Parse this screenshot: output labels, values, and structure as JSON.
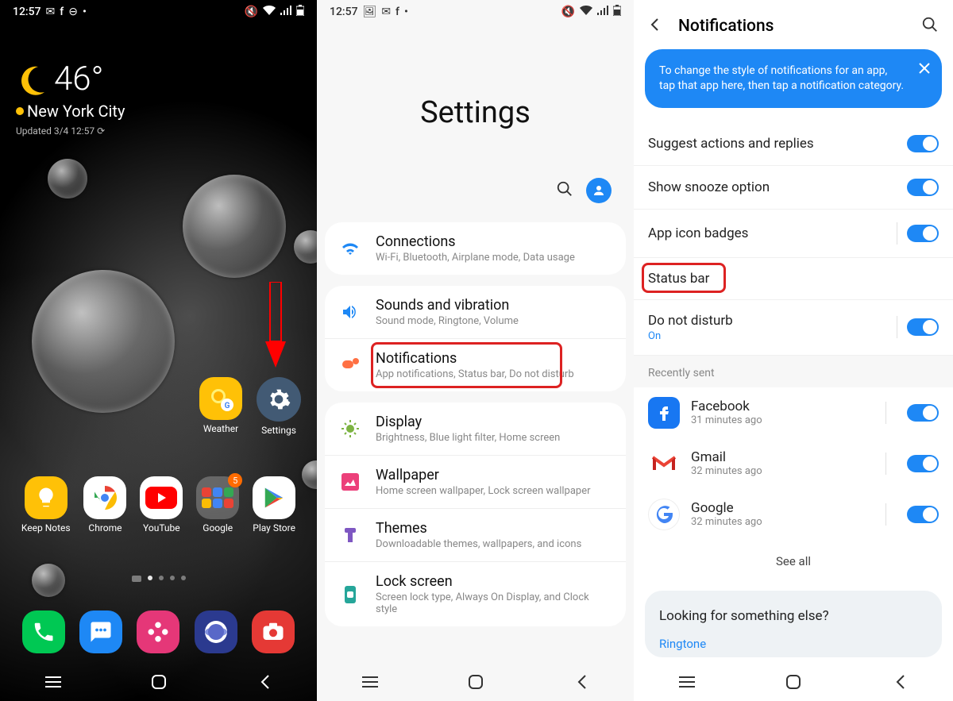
{
  "home": {
    "status_time": "12:57",
    "weather": {
      "temp": "46°",
      "city": "New York City",
      "updated": "Updated 3/4 12:57 ⟳"
    },
    "mid_icons": [
      {
        "label": "Weather",
        "bg": "#ffc107"
      },
      {
        "label": "Settings",
        "bg": "#425a74"
      }
    ],
    "app_row": [
      {
        "label": "Keep Notes",
        "bg": "#ffc107"
      },
      {
        "label": "Chrome",
        "bg": "#fff"
      },
      {
        "label": "YouTube",
        "bg": "#fff"
      },
      {
        "label": "Google",
        "bg": "#fff",
        "badge": "5"
      },
      {
        "label": "Play Store",
        "bg": "#fff"
      }
    ],
    "dock": [
      {
        "bg": "#00c853"
      },
      {
        "bg": "#1e88f5"
      },
      {
        "bg": "#e53778"
      },
      {
        "bg": "#2b3a8f"
      },
      {
        "bg": "#e53935"
      }
    ]
  },
  "settings": {
    "status_time": "12:57",
    "title": "Settings",
    "groups": [
      [
        {
          "icon": "wifi",
          "color": "#1e88f5",
          "title": "Connections",
          "sub": "Wi-Fi, Bluetooth, Airplane mode, Data usage"
        }
      ],
      [
        {
          "icon": "sound",
          "color": "#1e88f5",
          "title": "Sounds and vibration",
          "sub": "Sound mode, Ringtone, Volume"
        },
        {
          "icon": "notif",
          "color": "#ff7043",
          "title": "Notifications",
          "sub": "App notifications, Status bar, Do not disturb",
          "highlight": true
        }
      ],
      [
        {
          "icon": "display",
          "color": "#7cb342",
          "title": "Display",
          "sub": "Brightness, Blue light filter, Home screen"
        },
        {
          "icon": "wallpaper",
          "color": "#ec407a",
          "title": "Wallpaper",
          "sub": "Home screen wallpaper, Lock screen wallpaper"
        },
        {
          "icon": "themes",
          "color": "#7e57c2",
          "title": "Themes",
          "sub": "Downloadable themes, wallpapers, and icons"
        },
        {
          "icon": "lock",
          "color": "#26a69a",
          "title": "Lock screen",
          "sub": "Screen lock type, Always On Display, and Clock style"
        }
      ]
    ]
  },
  "notifs": {
    "title": "Notifications",
    "tip": "To change the style of notifications for an app, tap that app here, then tap a notification category.",
    "rows": [
      {
        "title": "Suggest actions and replies",
        "toggle": true
      },
      {
        "title": "Show snooze option",
        "toggle": true
      },
      {
        "title": "App icon badges",
        "toggle": true
      },
      {
        "title": "Status bar",
        "highlight": true
      },
      {
        "title": "Do not disturb",
        "sub": "On",
        "toggle": true
      }
    ],
    "section": "Recently sent",
    "apps": [
      {
        "name": "Facebook",
        "time": "31 minutes ago",
        "bg": "#1877f2"
      },
      {
        "name": "Gmail",
        "time": "32 minutes ago",
        "bg": "#fff"
      },
      {
        "name": "Google",
        "time": "32 minutes ago",
        "bg": "#fff"
      }
    ],
    "see_all": "See all",
    "looking_title": "Looking for something else?",
    "looking_link": "Ringtone"
  }
}
